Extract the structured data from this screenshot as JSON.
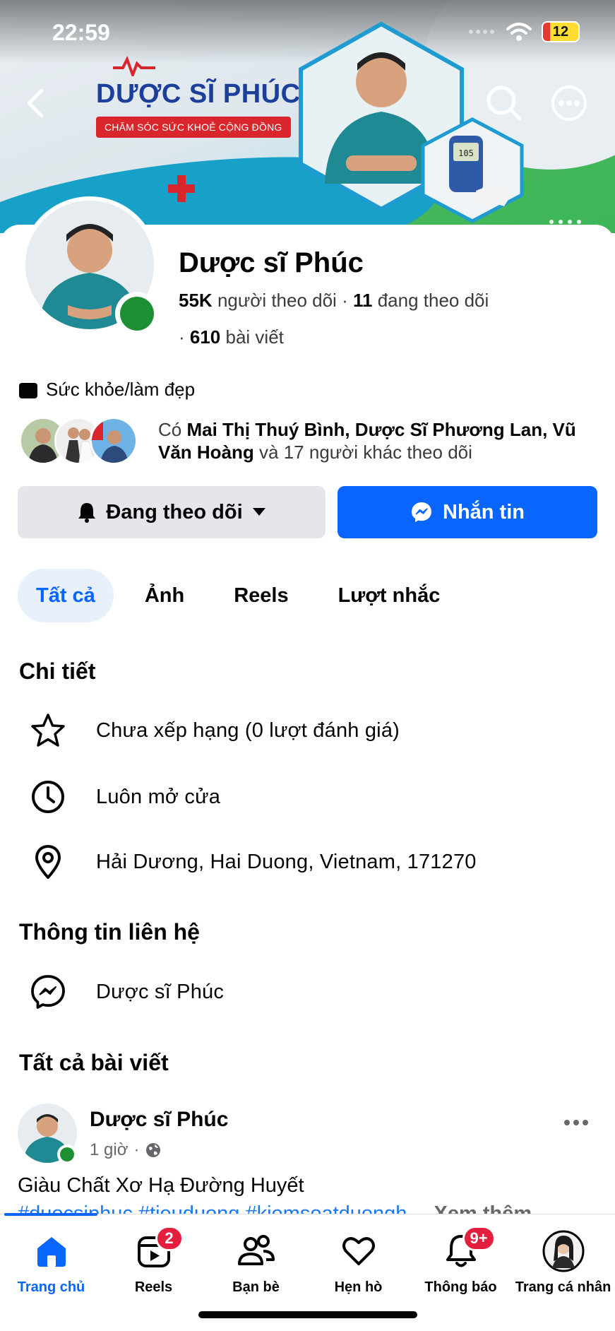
{
  "status_bar": {
    "time": "22:59",
    "battery": "12"
  },
  "cover": {
    "brand_title": "DƯỢC SĨ PHÚC",
    "brand_subtitle": "CHĂM SÓC SỨC KHOẺ CỘNG ĐỒNG",
    "glucose_reading": "105"
  },
  "profile": {
    "name": "Dược sĩ Phúc",
    "followers_count": "55K",
    "followers_label": "người theo dõi",
    "following_count": "11",
    "following_label": "đang theo dõi",
    "posts_count": "610",
    "posts_label": "bài viết",
    "category": "Sức khỏe/làm đẹp"
  },
  "mutual": {
    "prefix": "Có",
    "names": "Mai Thị Thuý Bình, Dược Sĩ Phương Lan, Vũ Văn Hoàng",
    "suffix": "và 17 người khác theo dõi"
  },
  "actions": {
    "following_label": "Đang theo dõi",
    "message_label": "Nhắn tin"
  },
  "tabs": [
    {
      "label": "Tất cả"
    },
    {
      "label": "Ảnh"
    },
    {
      "label": "Reels"
    },
    {
      "label": "Lượt nhắc"
    }
  ],
  "details": {
    "title": "Chi tiết",
    "rating": "Chưa xếp hạng (0 lượt đánh giá)",
    "hours": "Luôn mở cửa",
    "address": "Hải Dương, Hai Duong, Vietnam, 171270"
  },
  "contact": {
    "title": "Thông tin liên hệ",
    "messenger": "Dược sĩ Phúc"
  },
  "posts": {
    "title": "Tất cả bài viết",
    "author": "Dược sĩ Phúc",
    "time": "1 giờ",
    "text": "Giàu Chất Xơ Hạ Đường Huyết",
    "tags": "#duocsiphuc #tieuduong #kiemsoatduongh",
    "see_more": "Xem thêm"
  },
  "bottom_nav": [
    {
      "label": "Trang chủ",
      "badge": ""
    },
    {
      "label": "Reels",
      "badge": "2"
    },
    {
      "label": "Bạn bè",
      "badge": ""
    },
    {
      "label": "Hẹn hò",
      "badge": ""
    },
    {
      "label": "Thông báo",
      "badge": "9+"
    },
    {
      "label": "Trang cá nhân",
      "badge": ""
    }
  ],
  "colors": {
    "accent": "#0866ff",
    "online": "#1f8f33",
    "badge": "#e41e3f",
    "brand": "#1b3f9a"
  }
}
